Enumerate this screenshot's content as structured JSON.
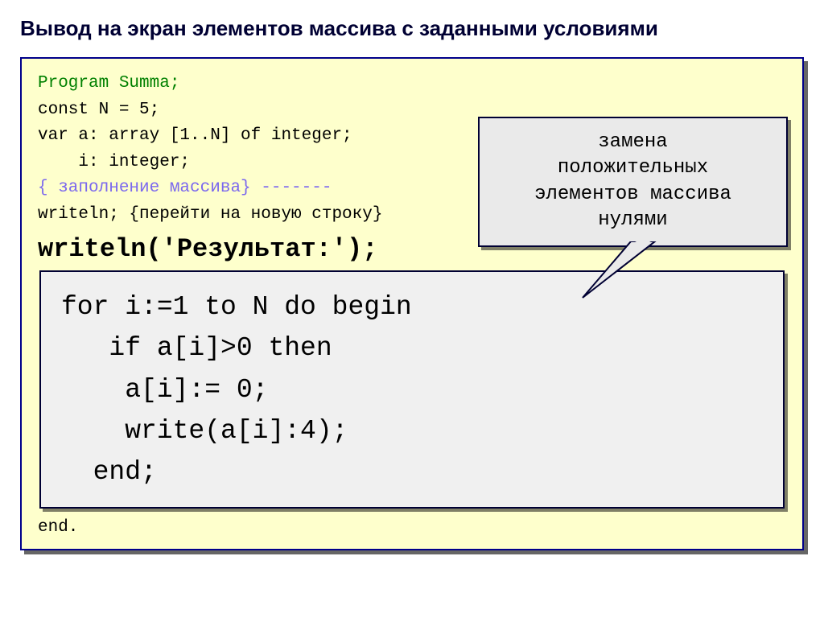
{
  "title": "Вывод на экран элементов массива с заданными условиями",
  "code": {
    "program": "Program Summa;",
    "const": "const N = 5;",
    "var_a": "var a: array [1..N] of integer;",
    "var_i": "    i: integer;",
    "fill_comment": "{ заполнение массива} -------",
    "writeln_newline": "writeln; {перейти на новую строку}",
    "writeln_result": "writeln('Результат:');",
    "loop": {
      "l1": "for i:=1 to N do begin",
      "l2": "   if a[i]>0 then",
      "l3": "    a[i]:= 0;",
      "l4": "    write(a[i]:4);",
      "l5": "  end;"
    },
    "end": "end."
  },
  "callout": {
    "l1": "замена",
    "l2": "положительных",
    "l3": "элементов массива",
    "l4": "нулями"
  }
}
